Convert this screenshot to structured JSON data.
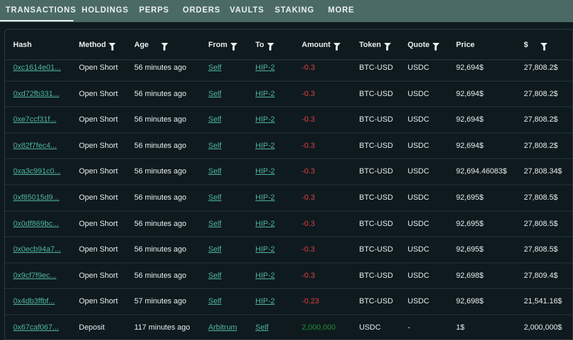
{
  "tabs": [
    {
      "label": "TRANSACTIONS"
    },
    {
      "label": "HOLDINGS"
    },
    {
      "label": "PERPS"
    },
    {
      "label": "ORDERS"
    },
    {
      "label": "VAULTS"
    },
    {
      "label": "STAKING"
    },
    {
      "label": "MORE"
    }
  ],
  "columns": [
    {
      "label": "Hash"
    },
    {
      "label": "Method"
    },
    {
      "label": "Age"
    },
    {
      "label": "From"
    },
    {
      "label": "To"
    },
    {
      "label": "Amount"
    },
    {
      "label": "Token"
    },
    {
      "label": "Quote"
    },
    {
      "label": "Price"
    },
    {
      "label": "$"
    }
  ],
  "rows": [
    {
      "hash": "0xc1614e01...",
      "method": "Open Short",
      "age": "56 minutes ago",
      "from": "Self",
      "to": "HIP-2",
      "amount": "-0.3",
      "token": "BTC-USD",
      "quote": "USDC",
      "price": "92,694$",
      "usd": "27,808.2$"
    },
    {
      "hash": "0xd72fb331...",
      "method": "Open Short",
      "age": "56 minutes ago",
      "from": "Self",
      "to": "HIP-2",
      "amount": "-0.3",
      "token": "BTC-USD",
      "quote": "USDC",
      "price": "92,694$",
      "usd": "27,808.2$"
    },
    {
      "hash": "0xe7ccf31f...",
      "method": "Open Short",
      "age": "56 minutes ago",
      "from": "Self",
      "to": "HIP-2",
      "amount": "-0.3",
      "token": "BTC-USD",
      "quote": "USDC",
      "price": "92,694$",
      "usd": "27,808.2$"
    },
    {
      "hash": "0x82f7fec4...",
      "method": "Open Short",
      "age": "56 minutes ago",
      "from": "Self",
      "to": "HIP-2",
      "amount": "-0.3",
      "token": "BTC-USD",
      "quote": "USDC",
      "price": "92,694$",
      "usd": "27,808.2$"
    },
    {
      "hash": "0xa3c991c0...",
      "method": "Open Short",
      "age": "56 minutes ago",
      "from": "Self",
      "to": "HIP-2",
      "amount": "-0.3",
      "token": "BTC-USD",
      "quote": "USDC",
      "price": "92,694.46083$",
      "usd": "27,808.34$"
    },
    {
      "hash": "0xf85015d9...",
      "method": "Open Short",
      "age": "56 minutes ago",
      "from": "Self",
      "to": "HIP-2",
      "amount": "-0.3",
      "token": "BTC-USD",
      "quote": "USDC",
      "price": "92,695$",
      "usd": "27,808.5$"
    },
    {
      "hash": "0x0df869bc...",
      "method": "Open Short",
      "age": "56 minutes ago",
      "from": "Self",
      "to": "HIP-2",
      "amount": "-0.3",
      "token": "BTC-USD",
      "quote": "USDC",
      "price": "92,695$",
      "usd": "27,808.5$"
    },
    {
      "hash": "0x0ecb94a7...",
      "method": "Open Short",
      "age": "56 minutes ago",
      "from": "Self",
      "to": "HIP-2",
      "amount": "-0.3",
      "token": "BTC-USD",
      "quote": "USDC",
      "price": "92,695$",
      "usd": "27,808.5$"
    },
    {
      "hash": "0x9cf7f9ec...",
      "method": "Open Short",
      "age": "56 minutes ago",
      "from": "Self",
      "to": "HIP-2",
      "amount": "-0.3",
      "token": "BTC-USD",
      "quote": "USDC",
      "price": "92,698$",
      "usd": "27,809.4$"
    },
    {
      "hash": "0x4db3ffbf...",
      "method": "Open Short",
      "age": "57 minutes ago",
      "from": "Self",
      "to": "HIP-2",
      "amount": "-0.23",
      "token": "BTC-USD",
      "quote": "USDC",
      "price": "92,698$",
      "usd": "21,541.16$"
    },
    {
      "hash": "0x67caf067...",
      "method": "Deposit",
      "age": "117 minutes ago",
      "from": "Arbitrum",
      "to": "Self",
      "amount": "2,000,000",
      "token": "USDC",
      "quote": "-",
      "price": "1$",
      "usd": "2,000,000$"
    }
  ],
  "colors": {
    "negative": "#e14040",
    "positive": "#1f8f35",
    "link": "#4fb89a",
    "tab_bar": "#4b6a66"
  }
}
